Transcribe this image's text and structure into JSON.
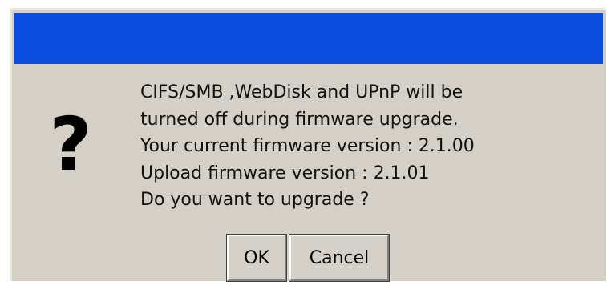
{
  "dialog": {
    "title": "",
    "icon": "question-mark-icon",
    "icon_glyph": "?",
    "message_lines": [
      "CIFS/SMB ,WebDisk and UPnP will be",
      "turned off during firmware upgrade.",
      "Your current firmware version : 2.1.00",
      "Upload firmware version : 2.1.01",
      "Do you want to upgrade ?"
    ],
    "ok_label": "OK",
    "cancel_label": "Cancel"
  },
  "colors": {
    "titlebar": "#0a4de0",
    "dialog_bg": "#d4d0c8"
  }
}
